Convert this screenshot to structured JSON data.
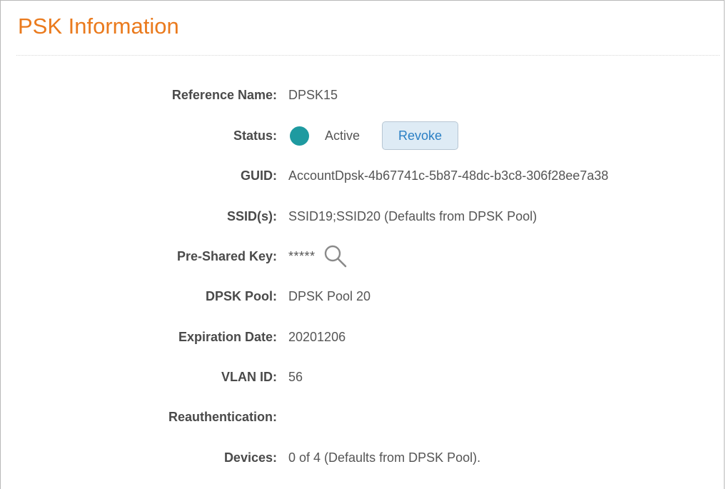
{
  "header": {
    "title": "PSK Information"
  },
  "fields": {
    "reference_name": {
      "label": "Reference Name:",
      "value": "DPSK15"
    },
    "status": {
      "label": "Status:",
      "value": "Active",
      "dot_color": "#1e9aa0",
      "revoke_label": "Revoke"
    },
    "guid": {
      "label": "GUID:",
      "value": "AccountDpsk-4b67741c-5b87-48dc-b3c8-306f28ee7a38"
    },
    "ssids": {
      "label": "SSID(s):",
      "value": "SSID19;SSID20 (Defaults from DPSK Pool)"
    },
    "psk": {
      "label": "Pre-Shared Key:",
      "value": "*****",
      "icon": "search-icon"
    },
    "dpsk_pool": {
      "label": "DPSK Pool:",
      "value": "DPSK Pool 20"
    },
    "expiration_date": {
      "label": "Expiration Date:",
      "value": "20201206"
    },
    "vlan_id": {
      "label": "VLAN ID:",
      "value": "56"
    },
    "reauthentication": {
      "label": "Reauthentication:",
      "value": ""
    },
    "devices": {
      "label": "Devices:",
      "value": "0 of 4 (Defaults from DPSK Pool)."
    }
  },
  "colors": {
    "title": "#ea7a1d",
    "accent_button_bg": "#deebf5",
    "accent_button_text": "#2a7fc4",
    "status_active": "#1e9aa0"
  }
}
